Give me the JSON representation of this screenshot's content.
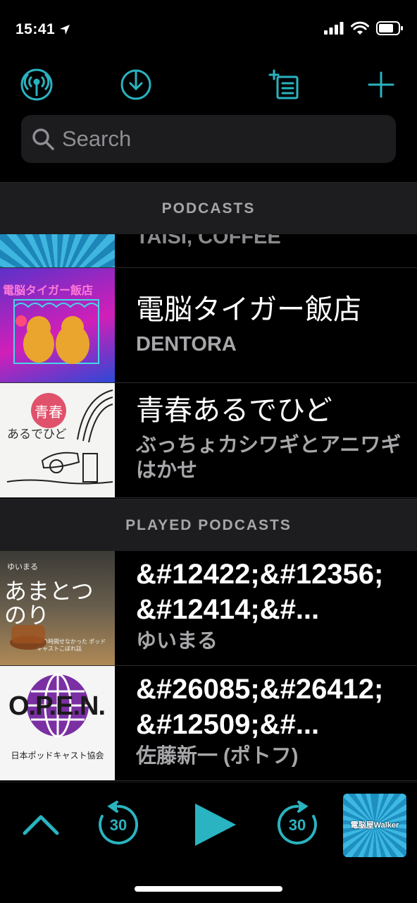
{
  "status_bar": {
    "time": "15:41"
  },
  "search": {
    "placeholder": "Search"
  },
  "sections": {
    "podcasts": "PODCASTS",
    "played": "PLAYED PODCASTS"
  },
  "podcasts": [
    {
      "title": "",
      "subtitle": "TAISI, COFFEE"
    },
    {
      "title": "電脳タイガー飯店",
      "subtitle": "DENTORA",
      "art_text": "電脳タイガー飯店"
    },
    {
      "title": "青春あるでひど",
      "subtitle": "ぶっちょカシワギとアニワギはかせ",
      "art_text": "青春",
      "art_text2": "あるでひど"
    }
  ],
  "played_podcasts": [
    {
      "title": "&#12422;&#12356;&#12414;&#...",
      "subtitle": "ゆいまる",
      "art_label": "ゆいまる",
      "art_big": "あまとつのり",
      "art_small": "あの時間せなかった ポッドキャストこぼれ話"
    },
    {
      "title": "&#26085;&#26412;&#12509;&#...",
      "subtitle": "佐藤新一 (ポトフ)",
      "art_big": "O.P.E.N.",
      "art_small": "日本ポッドキャスト協会"
    }
  ],
  "player": {
    "skip_back_seconds": "30",
    "skip_forward_seconds": "30",
    "now_playing_art_text": "電脳屋Walker"
  },
  "colors": {
    "accent": "#2ab3c0",
    "background": "#000000",
    "header_bg": "#1d1d1f"
  }
}
